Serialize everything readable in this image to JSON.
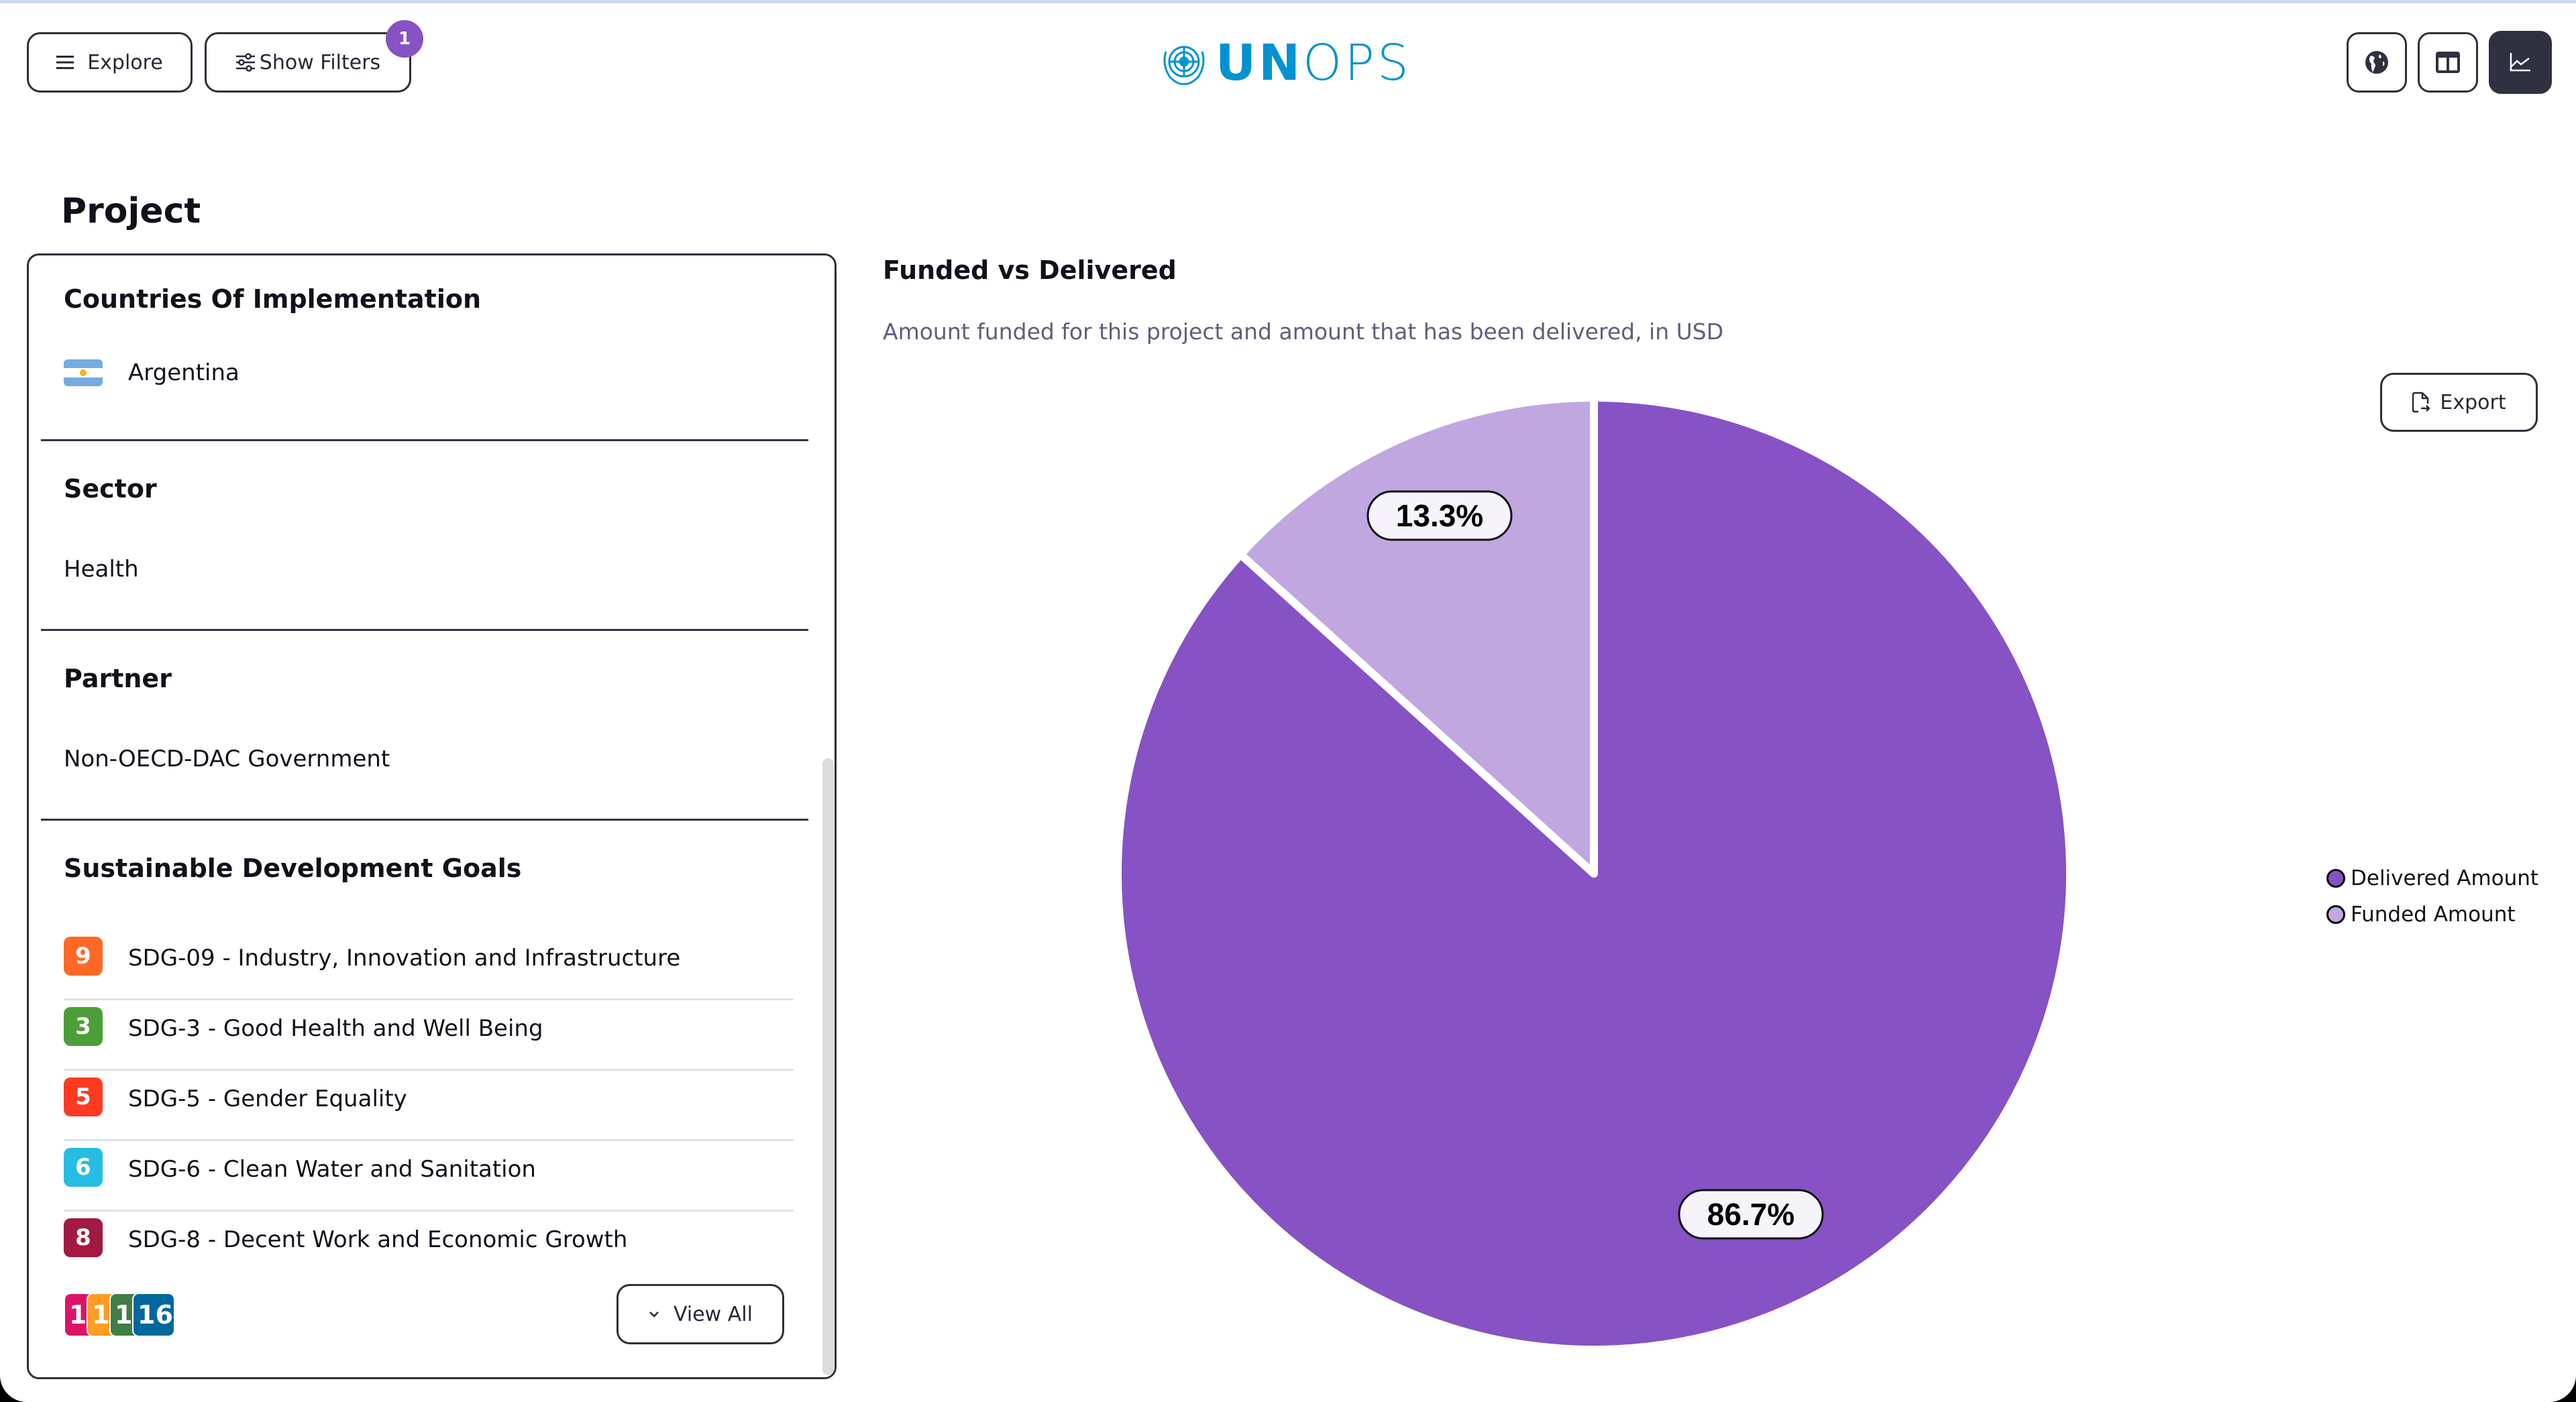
{
  "header": {
    "explore_label": "Explore",
    "show_filters_label": "Show Filters",
    "filters_badge_count": "1",
    "logo_text_bold": "UN",
    "logo_text_light": "OPS",
    "view_buttons": [
      {
        "name": "map-view",
        "icon": "globe-icon",
        "active": false
      },
      {
        "name": "table-view",
        "icon": "columns-icon",
        "active": false
      },
      {
        "name": "chart-view",
        "icon": "line-chart-icon",
        "active": true
      }
    ]
  },
  "page": {
    "title": "Project"
  },
  "details": {
    "countries": {
      "title": "Countries Of Implementation",
      "items": [
        {
          "name": "Argentina",
          "flag": "argentina-flag-icon"
        }
      ]
    },
    "sector": {
      "title": "Sector",
      "value": "Health"
    },
    "partner": {
      "title": "Partner",
      "value": "Non-OECD-DAC Government"
    },
    "sdgs": {
      "title": "Sustainable Development Goals",
      "items": [
        {
          "number": "9",
          "label": "SDG-09 - Industry, Innovation and Infrastructure",
          "color": "#fd6925"
        },
        {
          "number": "3",
          "label": "SDG-3 - Good Health and Well Being",
          "color": "#4c9f38"
        },
        {
          "number": "5",
          "label": "SDG-5 - Gender Equality",
          "color": "#ff3a21"
        },
        {
          "number": "6",
          "label": "SDG-6 - Clean Water and Sanitation",
          "color": "#26bde2"
        },
        {
          "number": "8",
          "label": "SDG-8 - Decent Work and Economic Growth",
          "color": "#a21942"
        }
      ],
      "more_icons": [
        {
          "number": "10",
          "color": "#dd1367"
        },
        {
          "number": "11",
          "color": "#fd9d24"
        },
        {
          "number": "13",
          "color": "#3f7e44"
        },
        {
          "number": "16",
          "color": "#00689d"
        }
      ],
      "view_all_label": "View All"
    }
  },
  "chart": {
    "title": "Funded vs Delivered",
    "subtitle": "Amount funded for this project and amount that has been delivered, in USD",
    "export_label": "Export"
  },
  "chart_data": {
    "type": "pie",
    "title": "Funded vs Delivered",
    "subtitle": "Amount funded for this project and amount that has been delivered, in USD",
    "unit": "USD",
    "slices": [
      {
        "name": "Delivered Amount",
        "percent": 86.7,
        "label": "86.7%",
        "color": "#8652c4"
      },
      {
        "name": "Funded Amount",
        "percent": 13.3,
        "label": "13.3%",
        "color": "#c0a7e0"
      }
    ],
    "legend": {
      "position": "right",
      "entries": [
        "Delivered Amount",
        "Funded Amount"
      ]
    }
  }
}
